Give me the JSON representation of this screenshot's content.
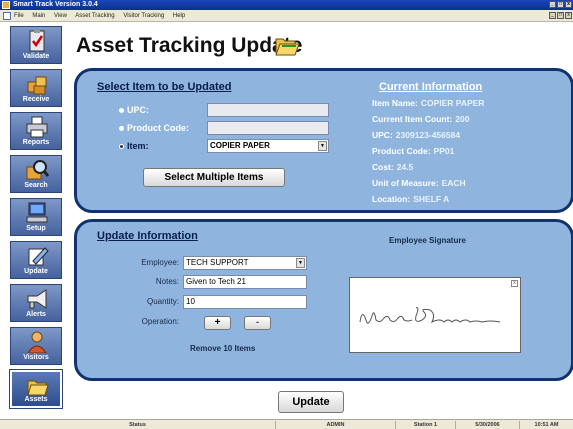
{
  "window": {
    "title": "Smart Track Version 3.0.4"
  },
  "menu": [
    "File",
    "Main",
    "View",
    "Asset Tracking",
    "Visitor Tracking",
    "Help"
  ],
  "sidebar": [
    {
      "label": "Validate",
      "icon": "clipboard-check-icon"
    },
    {
      "label": "Receive",
      "icon": "boxes-icon"
    },
    {
      "label": "Reports",
      "icon": "printer-icon"
    },
    {
      "label": "Search",
      "icon": "magnifier-box-icon"
    },
    {
      "label": "Setup",
      "icon": "computer-icon"
    },
    {
      "label": "Update",
      "icon": "pencil-icon"
    },
    {
      "label": "Alerts",
      "icon": "megaphone-icon"
    },
    {
      "label": "Visitors",
      "icon": "person-icon"
    },
    {
      "label": "Assets",
      "icon": "folders-icon"
    }
  ],
  "page": {
    "title": "Asset Tracking Update",
    "title_icon": "folders-icon"
  },
  "select": {
    "heading": "Select Item to be Updated",
    "upc_label": "UPC:",
    "upc_value": "",
    "product_code_label": "Product Code:",
    "product_code_value": "",
    "item_label": "Item:",
    "item_value": "COPIER PAPER",
    "multi_button": "Select Multiple Items"
  },
  "current": {
    "heading": "Current Information",
    "fields": [
      {
        "label": "Item Name:",
        "value": "COPIER PAPER"
      },
      {
        "label": "Current Item Count:",
        "value": "200"
      },
      {
        "label": "UPC:",
        "value": "2309123-456584"
      },
      {
        "label": "Product Code:",
        "value": "PP01"
      },
      {
        "label": "Cost:",
        "value": "24.5"
      },
      {
        "label": "Unit of Measure:",
        "value": "EACH"
      },
      {
        "label": "Location:",
        "value": "SHELF A"
      }
    ]
  },
  "update": {
    "heading": "Update Information",
    "employee_label": "Employee:",
    "employee_value": "TECH SUPPORT",
    "notes_label": "Notes:",
    "notes_value": "Given to Tech 21",
    "quantity_label": "Quantity:",
    "quantity_value": "10",
    "operation_label": "Operation:",
    "plus_label": "+",
    "minus_label": "-",
    "summary": "Remove 10 Items",
    "signature_title": "Employee Signature",
    "signature_close": "x"
  },
  "update_button": "Update",
  "status": {
    "status": "Status",
    "user": "ADMIN",
    "station": "Station 1",
    "date": "5/30/2006",
    "time": "10:51 AM"
  },
  "colors": {
    "panel": "#8fb5de",
    "panel_border": "#10336e",
    "nav": "#46629e"
  }
}
